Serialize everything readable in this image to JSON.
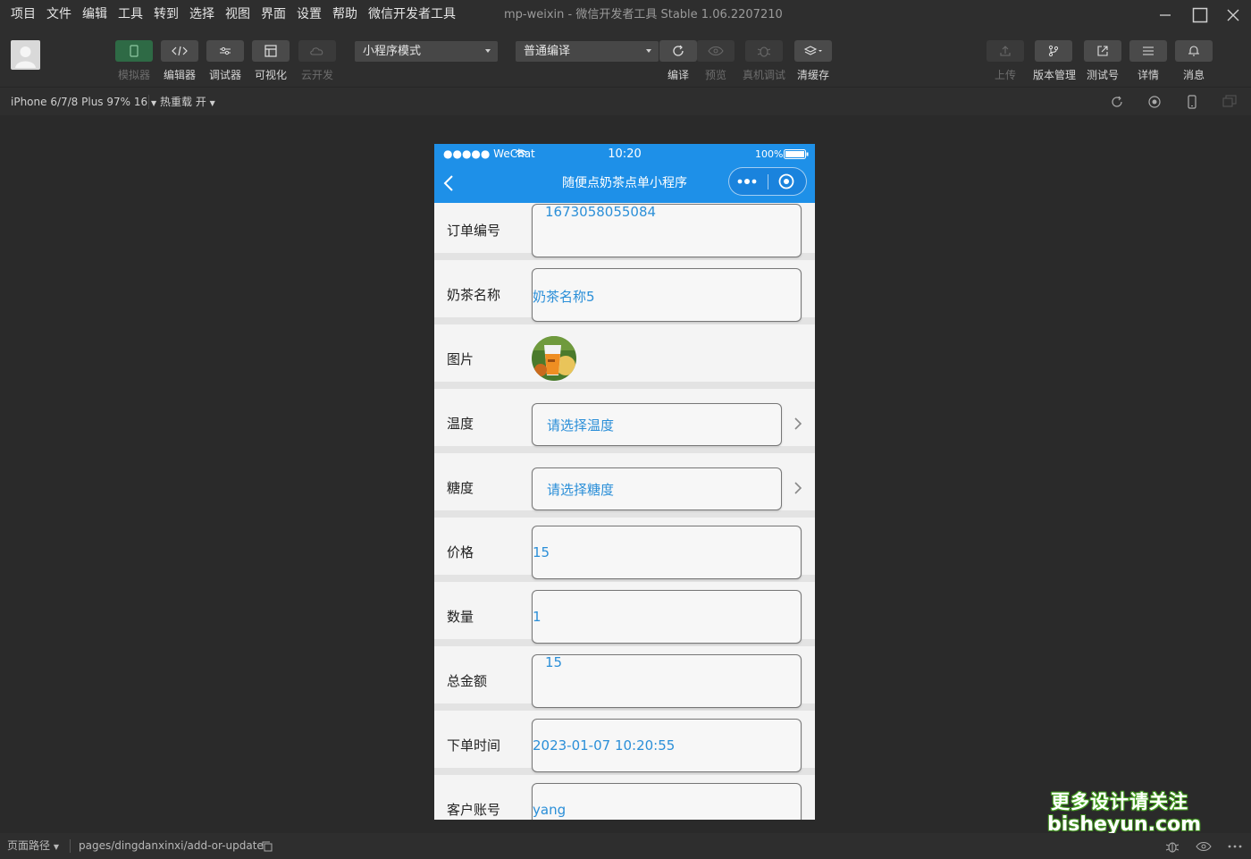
{
  "menubar": {
    "items": [
      "项目",
      "文件",
      "编辑",
      "工具",
      "转到",
      "选择",
      "视图",
      "界面",
      "设置",
      "帮助",
      "微信开发者工具"
    ],
    "title": "mp-weixin - 微信开发者工具 Stable 1.06.2207210"
  },
  "toolbar": {
    "simulator": "模拟器",
    "editor": "编辑器",
    "debugger": "调试器",
    "visual": "可视化",
    "cloud": "云开发",
    "mode_select": "小程序模式",
    "compile_select": "普通编译",
    "compile": "编译",
    "preview": "预览",
    "remote_debug": "真机调试",
    "clear_cache": "清缓存",
    "upload": "上传",
    "version": "版本管理",
    "test_account": "测试号",
    "details": "详情",
    "messages": "消息"
  },
  "subbar": {
    "device": "iPhone 6/7/8 Plus 97% 16",
    "hot_reload": "热重载 开"
  },
  "phone": {
    "carrier": "●●●●● WeChat",
    "time": "10:20",
    "battery": "100%",
    "nav_title": "随便点奶茶点单小程序",
    "form": {
      "order_no_label": "订单编号",
      "order_no_value": "1673058055084",
      "tea_name_label": "奶茶名称",
      "tea_name_value": "奶茶名称5",
      "image_label": "图片",
      "temp_label": "温度",
      "temp_placeholder": "请选择温度",
      "sugar_label": "糖度",
      "sugar_placeholder": "请选择糖度",
      "price_label": "价格",
      "price_value": "15",
      "qty_label": "数量",
      "qty_value": "1",
      "total_label": "总金额",
      "total_value": "15",
      "time_label": "下单时间",
      "time_value": "2023-01-07 10:20:55",
      "account_label": "客户账号",
      "account_value": "yang"
    }
  },
  "watermark": {
    "line1": "更多设计请关注",
    "line2": "bisheyun.com"
  },
  "bottombar": {
    "path_label": "页面路径",
    "path_value": "pages/dingdanxinxi/add-or-update"
  }
}
